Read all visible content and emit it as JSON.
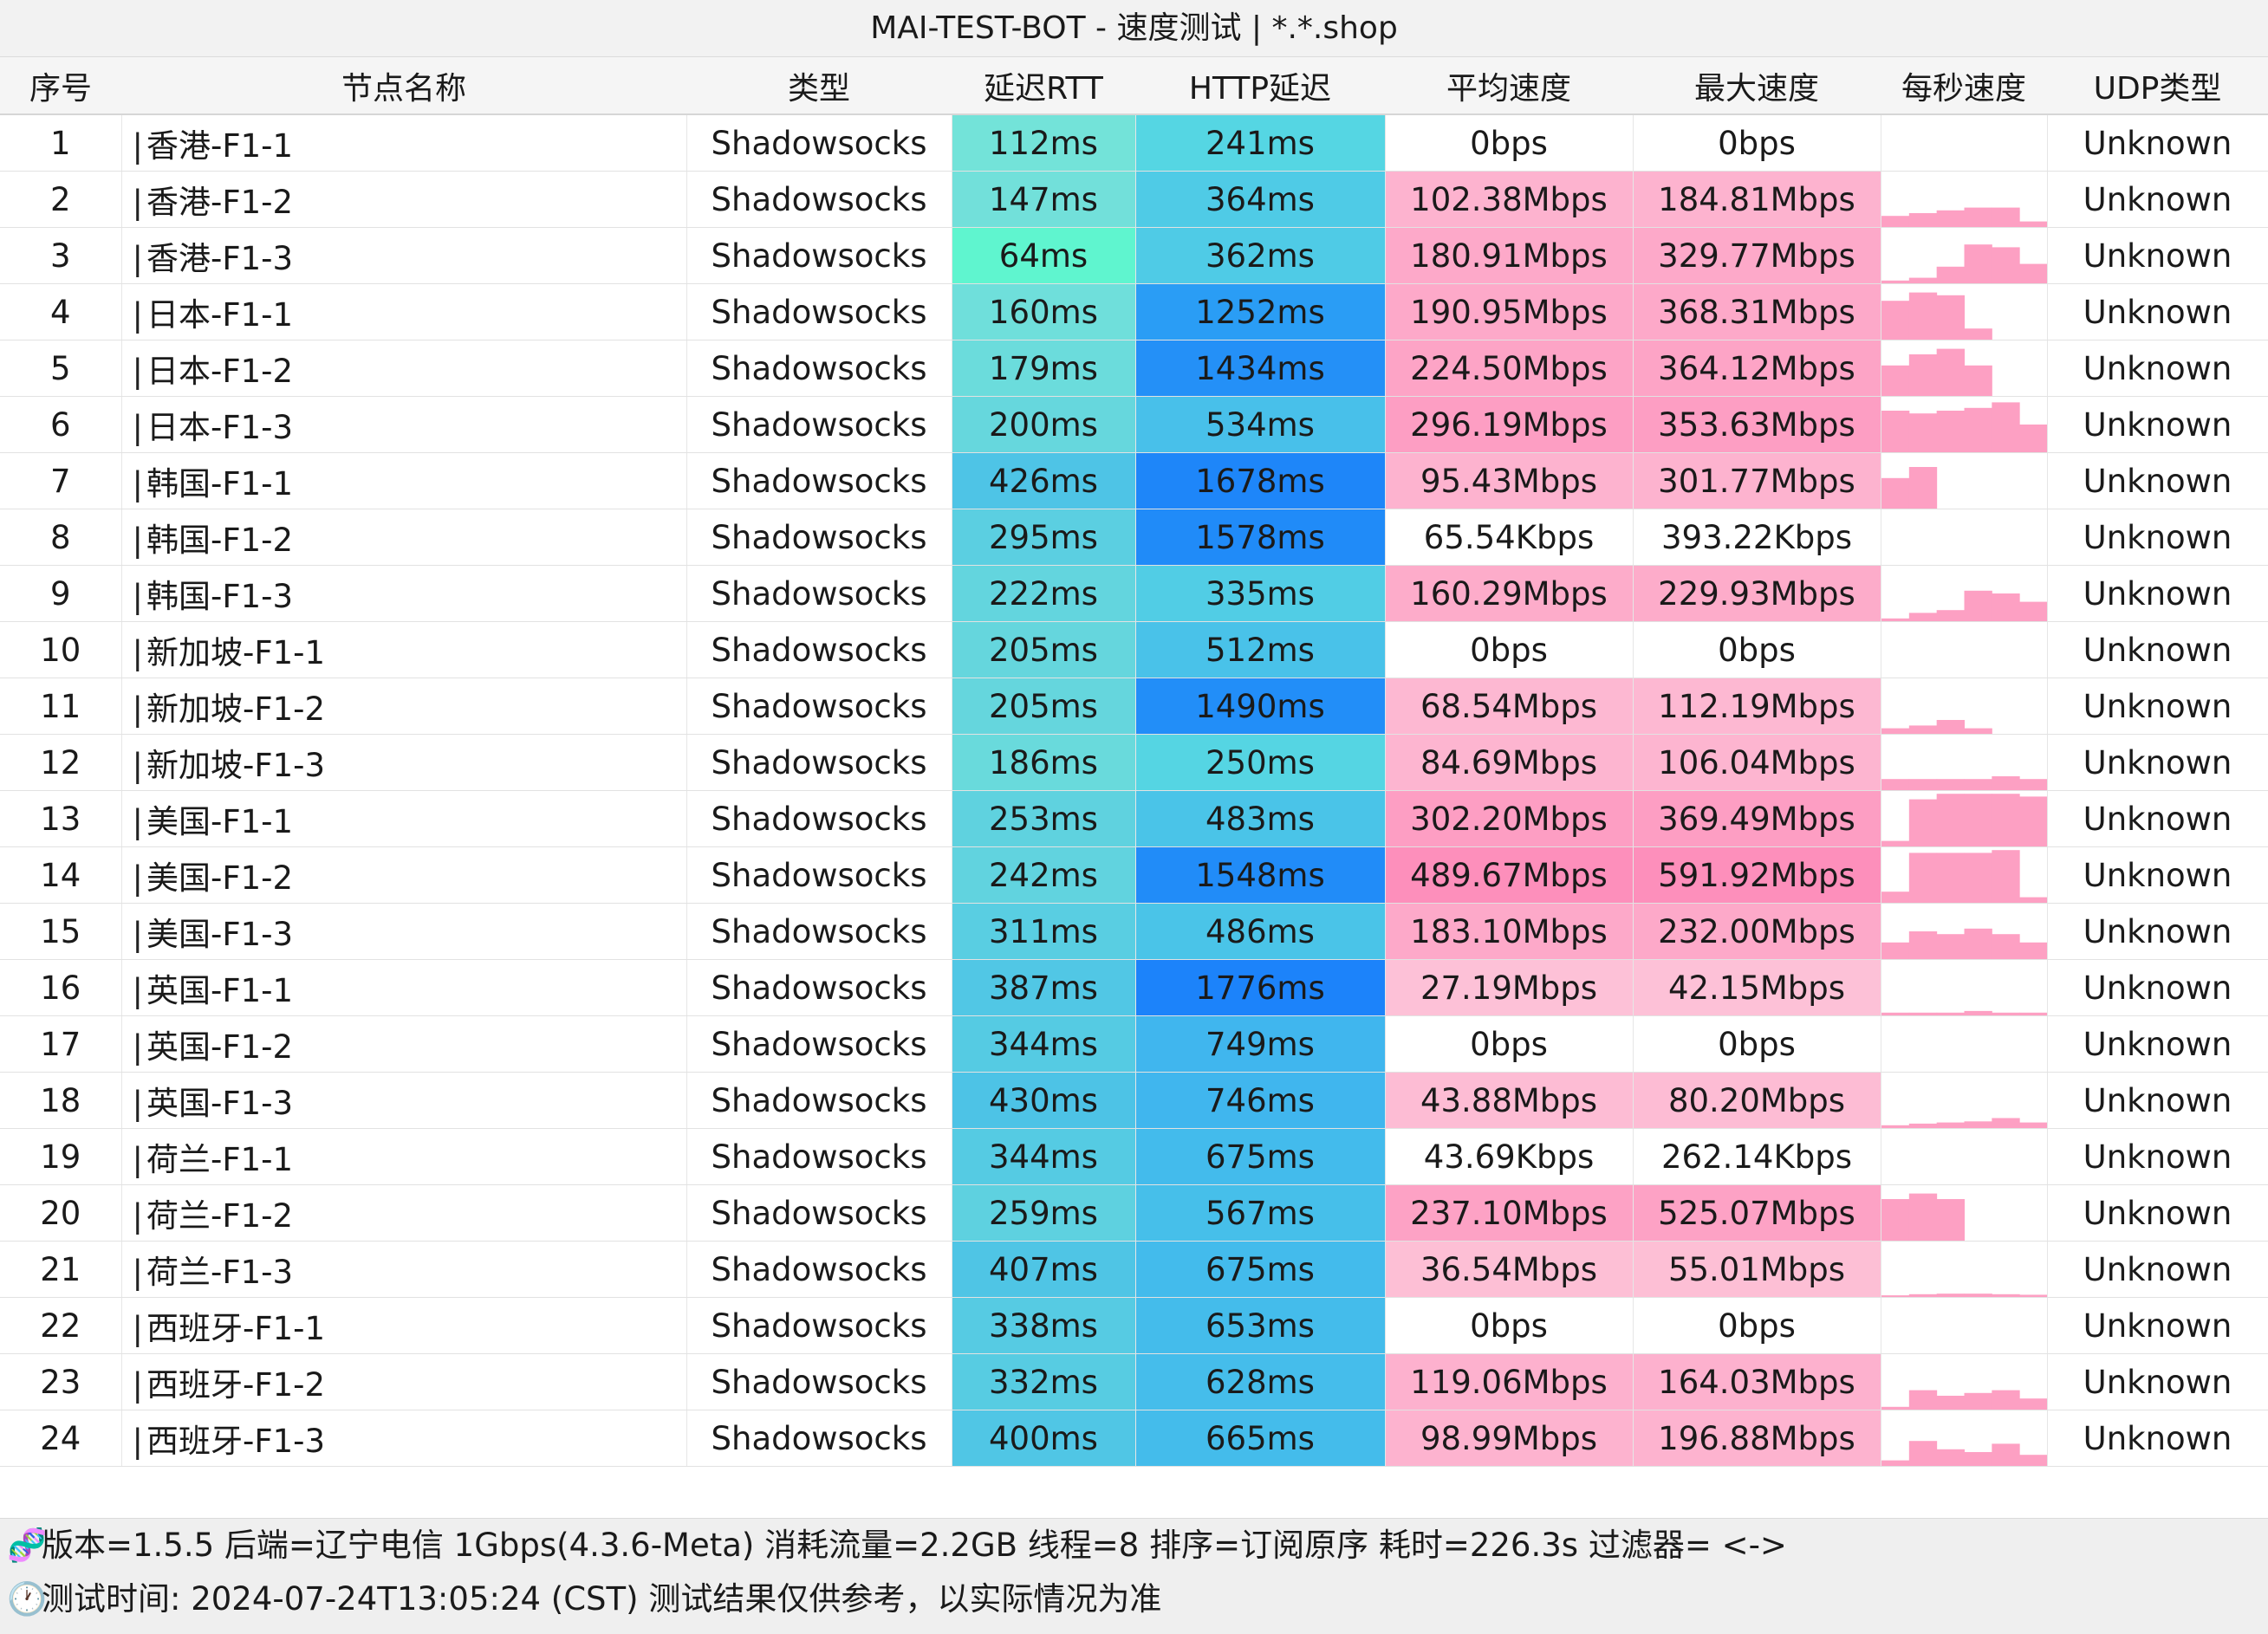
{
  "window": {
    "title": "MAI-TEST-BOT - 速度测试 | *.*.shop"
  },
  "table": {
    "columns": [
      "序号",
      "节点名称",
      "类型",
      "延迟RTT",
      "HTTP延迟",
      "平均速度",
      "最大速度",
      "每秒速度",
      "UDP类型"
    ],
    "rows": [
      {
        "idx": "1",
        "name": "香港-F1-1",
        "type": "Shadowsocks",
        "rtt": "112ms",
        "http": "241ms",
        "avg": "0bps",
        "max": "0bps",
        "udp": "Unknown",
        "rtt_color": "#73e3d9",
        "http_color": "#55d6e3",
        "speed_color": "#ffffff",
        "spark": []
      },
      {
        "idx": "2",
        "name": "香港-F1-2",
        "type": "Shadowsocks",
        "rtt": "147ms",
        "http": "364ms",
        "avg": "102.38Mbps",
        "max": "184.81Mbps",
        "udp": "Unknown",
        "rtt_color": "#72e0da",
        "http_color": "#4fcbe6",
        "speed_color": "#fdb3cf",
        "spark": [
          0.2,
          0.25,
          0.3,
          0.35,
          0.35,
          0.1
        ]
      },
      {
        "idx": "3",
        "name": "香港-F1-3",
        "type": "Shadowsocks",
        "rtt": "64ms",
        "http": "362ms",
        "avg": "180.91Mbps",
        "max": "329.77Mbps",
        "udp": "Unknown",
        "rtt_color": "#5ff5cf",
        "http_color": "#4fcbe6",
        "speed_color": "#fda9c9",
        "spark": [
          0.05,
          0.1,
          0.3,
          0.7,
          0.65,
          0.35
        ]
      },
      {
        "idx": "4",
        "name": "日本-F1-1",
        "type": "Shadowsocks",
        "rtt": "160ms",
        "http": "1252ms",
        "avg": "190.95Mbps",
        "max": "368.31Mbps",
        "udp": "Unknown",
        "rtt_color": "#6fdfdb",
        "http_color": "#2a9df5",
        "speed_color": "#fda9c9",
        "spark": [
          0.7,
          0.85,
          0.8,
          0.2,
          0,
          0
        ]
      },
      {
        "idx": "5",
        "name": "日本-F1-2",
        "type": "Shadowsocks",
        "rtt": "179ms",
        "http": "1434ms",
        "avg": "224.50Mbps",
        "max": "364.12Mbps",
        "udp": "Unknown",
        "rtt_color": "#6bdcdc",
        "http_color": "#2490f7",
        "speed_color": "#fda4c6",
        "spark": [
          0.55,
          0.75,
          0.85,
          0.55,
          0,
          0
        ]
      },
      {
        "idx": "6",
        "name": "日本-F1-3",
        "type": "Shadowsocks",
        "rtt": "200ms",
        "http": "534ms",
        "avg": "296.19Mbps",
        "max": "353.63Mbps",
        "udp": "Unknown",
        "rtt_color": "#66d7dd",
        "http_color": "#48c0ea",
        "speed_color": "#fd9ec3",
        "spark": [
          0.75,
          0.7,
          0.75,
          0.8,
          0.9,
          0.5
        ]
      },
      {
        "idx": "7",
        "name": "韩国-F1-1",
        "type": "Shadowsocks",
        "rtt": "426ms",
        "http": "1678ms",
        "avg": "95.43Mbps",
        "max": "301.77Mbps",
        "udp": "Unknown",
        "rtt_color": "#4ec4e6",
        "http_color": "#1e86f9",
        "speed_color": "#fdb3cf",
        "spark": [
          0.55,
          0.75,
          0,
          0,
          0,
          0
        ]
      },
      {
        "idx": "8",
        "name": "韩国-F1-2",
        "type": "Shadowsocks",
        "rtt": "295ms",
        "http": "1578ms",
        "avg": "65.54Kbps",
        "max": "393.22Kbps",
        "udp": "Unknown",
        "rtt_color": "#5bcfe1",
        "http_color": "#208bf8",
        "speed_color": "#ffffff",
        "spark": []
      },
      {
        "idx": "9",
        "name": "韩国-F1-3",
        "type": "Shadowsocks",
        "rtt": "222ms",
        "http": "335ms",
        "avg": "160.29Mbps",
        "max": "229.93Mbps",
        "udp": "Unknown",
        "rtt_color": "#63d5de",
        "http_color": "#51cde5",
        "speed_color": "#fdacca",
        "spark": [
          0.05,
          0.15,
          0.2,
          0.55,
          0.5,
          0.35
        ]
      },
      {
        "idx": "10",
        "name": "新加坡-F1-1",
        "type": "Shadowsocks",
        "rtt": "205ms",
        "http": "512ms",
        "avg": "0bps",
        "max": "0bps",
        "udp": "Unknown",
        "rtt_color": "#65d6dd",
        "http_color": "#49c2e9",
        "speed_color": "#ffffff",
        "spark": []
      },
      {
        "idx": "11",
        "name": "新加坡-F1-2",
        "type": "Shadowsocks",
        "rtt": "205ms",
        "http": "1490ms",
        "avg": "68.54Mbps",
        "max": "112.19Mbps",
        "udp": "Unknown",
        "rtt_color": "#65d6dd",
        "http_color": "#228ef8",
        "speed_color": "#fdb8d2",
        "spark": [
          0.1,
          0.15,
          0.25,
          0.1,
          0,
          0
        ]
      },
      {
        "idx": "12",
        "name": "新加坡-F1-3",
        "type": "Shadowsocks",
        "rtt": "186ms",
        "http": "250ms",
        "avg": "84.69Mbps",
        "max": "106.04Mbps",
        "udp": "Unknown",
        "rtt_color": "#69dadc",
        "http_color": "#55d5e3",
        "speed_color": "#fdb5d0",
        "spark": [
          0.2,
          0.2,
          0.2,
          0.2,
          0.25,
          0.2
        ]
      },
      {
        "idx": "13",
        "name": "美国-F1-1",
        "type": "Shadowsocks",
        "rtt": "253ms",
        "http": "483ms",
        "avg": "302.20Mbps",
        "max": "369.49Mbps",
        "udp": "Unknown",
        "rtt_color": "#5fd2df",
        "http_color": "#4ac4e8",
        "speed_color": "#fd9ec3",
        "spark": [
          0.1,
          0.85,
          0.95,
          0.95,
          0.95,
          0.9
        ]
      },
      {
        "idx": "14",
        "name": "美国-F1-2",
        "type": "Shadowsocks",
        "rtt": "242ms",
        "http": "1548ms",
        "avg": "489.67Mbps",
        "max": "591.92Mbps",
        "udp": "Unknown",
        "rtt_color": "#61d3df",
        "http_color": "#218cf8",
        "speed_color": "#fd8fbb",
        "spark": [
          0.2,
          0.9,
          0.9,
          0.9,
          0.95,
          0.1
        ]
      },
      {
        "idx": "15",
        "name": "美国-F1-3",
        "type": "Shadowsocks",
        "rtt": "311ms",
        "http": "486ms",
        "avg": "183.10Mbps",
        "max": "232.00Mbps",
        "udp": "Unknown",
        "rtt_color": "#59cee2",
        "http_color": "#4ac4e8",
        "speed_color": "#fda9c9",
        "spark": [
          0.3,
          0.5,
          0.45,
          0.55,
          0.45,
          0.3
        ]
      },
      {
        "idx": "16",
        "name": "英国-F1-1",
        "type": "Shadowsocks",
        "rtt": "387ms",
        "http": "1776ms",
        "avg": "27.19Mbps",
        "max": "42.15Mbps",
        "udp": "Unknown",
        "rtt_color": "#51c7e5",
        "http_color": "#1c83fa",
        "speed_color": "#fdc1d7",
        "spark": [
          0.05,
          0.05,
          0.05,
          0.08,
          0.05,
          0.05
        ]
      },
      {
        "idx": "17",
        "name": "英国-F1-2",
        "type": "Shadowsocks",
        "rtt": "344ms",
        "http": "749ms",
        "avg": "0bps",
        "max": "0bps",
        "udp": "Unknown",
        "rtt_color": "#55cbe3",
        "http_color": "#40b6ee",
        "speed_color": "#ffffff",
        "spark": []
      },
      {
        "idx": "18",
        "name": "英国-F1-3",
        "type": "Shadowsocks",
        "rtt": "430ms",
        "http": "746ms",
        "avg": "43.88Mbps",
        "max": "80.20Mbps",
        "udp": "Unknown",
        "rtt_color": "#4dc3e6",
        "http_color": "#40b6ee",
        "speed_color": "#fdbcd4",
        "spark": [
          0.05,
          0.08,
          0.1,
          0.12,
          0.18,
          0.1
        ]
      },
      {
        "idx": "19",
        "name": "荷兰-F1-1",
        "type": "Shadowsocks",
        "rtt": "344ms",
        "http": "675ms",
        "avg": "43.69Kbps",
        "max": "262.14Kbps",
        "udp": "Unknown",
        "rtt_color": "#55cbe3",
        "http_color": "#43bbec",
        "speed_color": "#ffffff",
        "spark": []
      },
      {
        "idx": "20",
        "name": "荷兰-F1-2",
        "type": "Shadowsocks",
        "rtt": "259ms",
        "http": "567ms",
        "avg": "237.10Mbps",
        "max": "525.07Mbps",
        "udp": "Unknown",
        "rtt_color": "#5ed1e0",
        "http_color": "#46bfea",
        "speed_color": "#fda2c5",
        "spark": [
          0.75,
          0.85,
          0.75,
          0,
          0,
          0
        ]
      },
      {
        "idx": "21",
        "name": "荷兰-F1-3",
        "type": "Shadowsocks",
        "rtt": "407ms",
        "http": "675ms",
        "avg": "36.54Mbps",
        "max": "55.01Mbps",
        "udp": "Unknown",
        "rtt_color": "#4fc5e5",
        "http_color": "#43bbec",
        "speed_color": "#fdbfd5",
        "spark": [
          0.03,
          0.05,
          0.06,
          0.06,
          0.05,
          0.04
        ]
      },
      {
        "idx": "22",
        "name": "西班牙-F1-1",
        "type": "Shadowsocks",
        "rtt": "338ms",
        "http": "653ms",
        "avg": "0bps",
        "max": "0bps",
        "udp": "Unknown",
        "rtt_color": "#56cbe3",
        "http_color": "#44bceb",
        "speed_color": "#ffffff",
        "spark": []
      },
      {
        "idx": "23",
        "name": "西班牙-F1-2",
        "type": "Shadowsocks",
        "rtt": "332ms",
        "http": "628ms",
        "avg": "119.06Mbps",
        "max": "164.03Mbps",
        "udp": "Unknown",
        "rtt_color": "#57cce2",
        "http_color": "#45bdeb",
        "speed_color": "#fdb1ce",
        "spark": [
          0.05,
          0.35,
          0.25,
          0.3,
          0.35,
          0.2
        ]
      },
      {
        "idx": "24",
        "name": "西班牙-F1-3",
        "type": "Shadowsocks",
        "rtt": "400ms",
        "http": "665ms",
        "avg": "98.99Mbps",
        "max": "196.88Mbps",
        "udp": "Unknown",
        "rtt_color": "#50c6e5",
        "http_color": "#44bceb",
        "speed_color": "#fdb3cf",
        "spark": [
          0.1,
          0.45,
          0.3,
          0.25,
          0.4,
          0.2
        ]
      }
    ]
  },
  "footer": {
    "line1": "版本=1.5.5  后端=辽宁电信 1Gbps(4.3.6-Meta) 消耗流量=2.2GB  线程=8  排序=订阅原序  耗时=226.3s  过滤器= <->",
    "line2": "测试时间: 2024-07-24T13:05:24 (CST)  测试结果仅供参考，以实际情况为准",
    "icon1": "dna-icon",
    "icon2": "clock-icon"
  },
  "colors": {
    "spark_fill": "#fda0c3",
    "header_bg": "#f5f5f5"
  }
}
